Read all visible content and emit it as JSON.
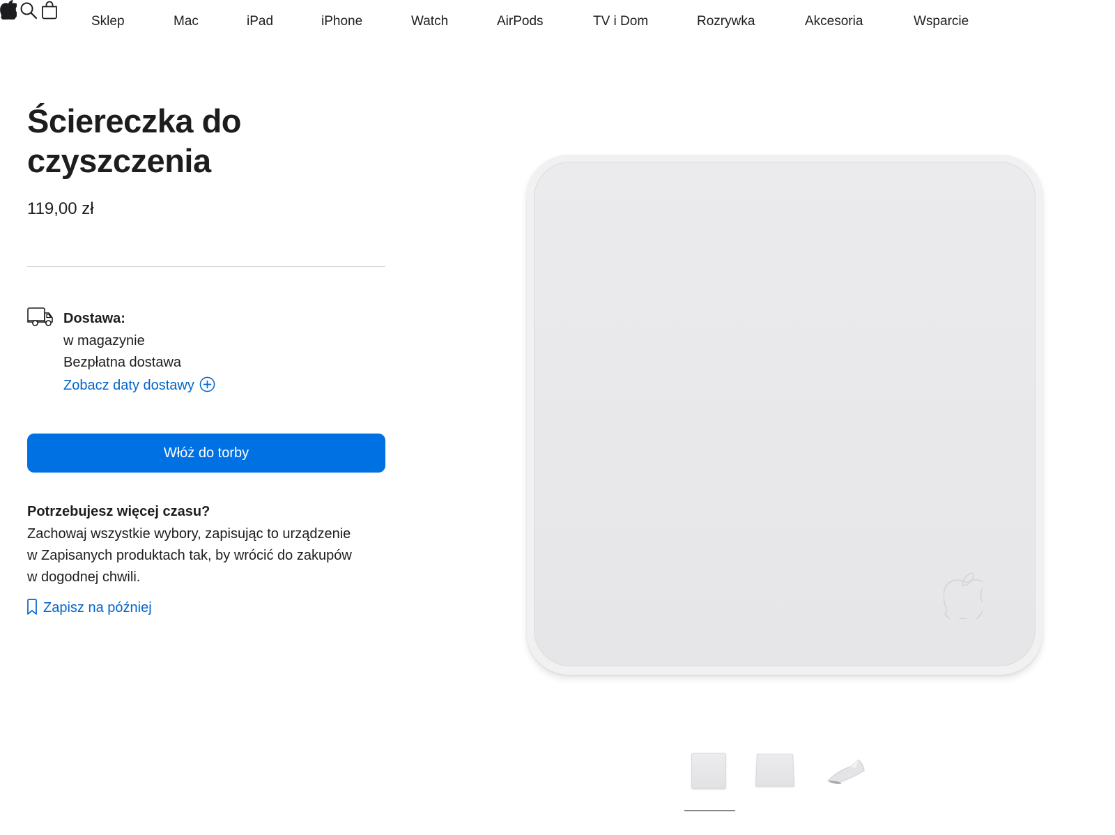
{
  "nav": {
    "items": [
      {
        "label": "Sklep"
      },
      {
        "label": "Mac"
      },
      {
        "label": "iPad"
      },
      {
        "label": "iPhone"
      },
      {
        "label": "Watch"
      },
      {
        "label": "AirPods"
      },
      {
        "label": "TV i Dom"
      },
      {
        "label": "Rozrywka"
      },
      {
        "label": "Akcesoria"
      },
      {
        "label": "Wsparcie"
      }
    ],
    "icons": {
      "logo": "apple-logo-icon",
      "search": "search-icon",
      "bag": "shopping-bag-icon"
    }
  },
  "product": {
    "title": "Ściereczka do czyszczenia",
    "price": "119,00 zł"
  },
  "delivery": {
    "icon": "truck-icon",
    "label": "Dostawa:",
    "availability": "w magazynie",
    "shipping": "Bezpłatna dostawa",
    "link_label": "Zobacz daty dostawy",
    "link_icon": "plus-circle-icon"
  },
  "cart": {
    "add_label": "Włóż do torby"
  },
  "save_for_later": {
    "heading": "Potrzebujesz więcej czasu?",
    "body": "Zachowaj wszystkie wybory, zapisując to urządzenie w Zapisanych produktach tak, by wrócić do zakupów w dogodnej chwili.",
    "link_label": "Zapisz na później",
    "link_icon": "bookmark-icon"
  },
  "gallery": {
    "thumbnails": [
      "polishing-cloth-front",
      "polishing-cloth-angled",
      "polishing-cloth-folded"
    ],
    "selected_index": 0
  },
  "colors": {
    "accent": "#0071e3",
    "link": "#0066cc",
    "text": "#1d1d1f",
    "divider": "#d2d2d7"
  }
}
